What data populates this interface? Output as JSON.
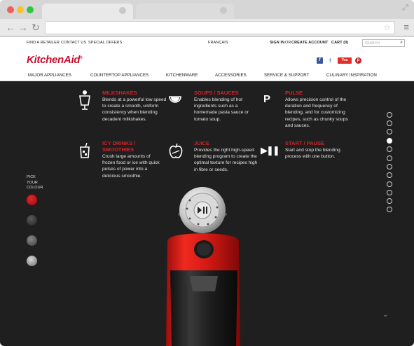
{
  "browser": {
    "tab_close": "×",
    "resize_icon": "⤢",
    "back": "←",
    "forward": "→",
    "reload": "↻",
    "bookmark_icon": "☆",
    "menu_icon": "≡",
    "dots": [
      "#f25f58",
      "#fbbe2e",
      "#2ec840"
    ]
  },
  "util_nav": {
    "find_retailer": "FIND A RETAILER",
    "contact": "CONTACT US",
    "offers": "SPECIAL OFFERS",
    "language": "FRANÇAIS",
    "sign_in": "SIGN IN",
    "or": "OR",
    "create_account": "CREATE ACCOUNT",
    "cart": "CART (0)",
    "search_placeholder": "SEARCH",
    "search_icon": "⌕"
  },
  "brand": {
    "logo": "KitchenAid",
    "logo_mark": "®",
    "accent": "#c8102e"
  },
  "social": {
    "facebook": "f",
    "twitter": "t",
    "youtube": "You",
    "pinterest": "p"
  },
  "main_nav": [
    "MAJOR APPLIANCES",
    "COUNTERTOP APPLIANCES",
    "KITCHENWARE",
    "ACCESSORIES",
    "SERVICE & SUPPORT",
    "CULINARY INSPIRATION"
  ],
  "features": [
    {
      "title": "MILKSHAKES",
      "text": "Blends at a powerful low speed to create a smooth, uniform consistency when blending decadent milkshakes.",
      "icon": "milkshake-icon"
    },
    {
      "title": "SOUPS / SAUCES",
      "text": "Enables blending of hot ingredients such as a homemade pasta sauce or tomato soup.",
      "icon": "soup-bowl-icon"
    },
    {
      "title": "PULSE",
      "text": "Allows precision control of the duration and frequency of blending, and for customizing recipes, such as chunky soups and sauces.",
      "icon": "pulse-icon",
      "glyph": "P"
    },
    {
      "title": "ICY DRINKS / SMOOTHIES",
      "text": "Crush large amounts of frozen food or ice with quick pulses of power into a delicious smoothie.",
      "icon": "icy-drink-icon"
    },
    {
      "title": "JUICE",
      "text": "Provides the right high-speed blending program to create the optimal texture for recipes high in fibre or seeds.",
      "icon": "apple-juice-icon"
    },
    {
      "title": "START / PAUSE",
      "text": "Start and stop the blending process with one button.",
      "icon": "play-pause-icon",
      "glyph": "▶❚❚"
    }
  ],
  "colour_picker": {
    "label": "PICK YOUR COLOUR",
    "swatches": [
      "#b8121a",
      "#3c3c3c",
      "#6a6a6a",
      "#a9a9a9"
    ]
  },
  "pager": {
    "count": 12,
    "active_index": 3
  },
  "scroll_hint": "⌄"
}
